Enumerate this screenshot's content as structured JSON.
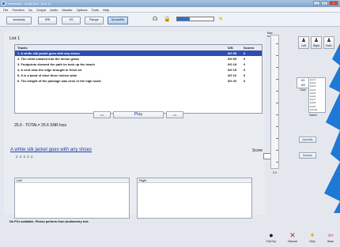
{
  "window": {
    "title": "Lessonsoft - Audio tool - [List 1]"
  },
  "menu": [
    "File",
    "Function",
    "Go",
    "Output",
    "Audio",
    "Monitor",
    "Options",
    "Tools",
    "Help"
  ],
  "toolbar": {
    "buttons": [
      {
        "label": "Audacity",
        "active": false
      },
      {
        "label": "SRI",
        "active": false
      },
      {
        "label": "SS",
        "active": false
      },
      {
        "label": "Range",
        "active": false
      },
      {
        "label": "SpeakMe",
        "active": true
      }
    ],
    "icons": [
      "headset-icon",
      "lock-icon",
      "sun-icon"
    ],
    "progress": 0.35,
    "accent": "#2e4eb3"
  },
  "list": {
    "title": "List 1",
    "columns": [
      "Tracks",
      "S/N",
      "Scores"
    ],
    "rows": [
      [
        "1. A white silk jacket goes with any shoes",
        "0/0 55",
        "0"
      ],
      [
        "2. The child crawled into the dense grass",
        "0/0 50",
        "0"
      ],
      [
        "3. Footprints showed the path he took up the beach",
        "0/0 18",
        "0"
      ],
      [
        "4. A vent near the edge brought in fresh air",
        "0/0 15",
        "0"
      ],
      [
        "5. It is a band of steel three inches wide",
        "0/0 10",
        "0"
      ],
      [
        "6. The weight of the package was seen in the high scale",
        "0/0 20",
        "0"
      ]
    ],
    "selected_row": 0
  },
  "playback": {
    "prev": "<<",
    "play": "Play",
    "next": ">>"
  },
  "totals": "25.6 - TOTAL= 25.6 SNR loss",
  "sentence": "A white silk jacket goes with any shoes",
  "phonemes": "2    2    2              2    2",
  "score": {
    "label": "Score",
    "value": ""
  },
  "panes": {
    "left": "Left",
    "right": "Right"
  },
  "status": "No PCs available. Please perform from Audiometry test.",
  "bottom_buttons": [
    {
      "label": "Full Grp",
      "icon": "person-icon"
    },
    {
      "label": "Discard",
      "icon": "close-icon"
    },
    {
      "label": "Help",
      "icon": "lightbulb-icon"
    },
    {
      "label": "Back",
      "icon": "back-arrow-icon"
    }
  ],
  "side": {
    "slider_top": "Max",
    "slider_top_value": "55 dB",
    "slider_bottom_value": "0.0",
    "talkers": [
      "Left",
      "Right",
      "Both"
    ],
    "count_box_label": "0/1",
    "count_box_sub": "100 Gain",
    "words": [
      "List 1",
      "List 2",
      "List 3",
      "List 4",
      "List 5",
      "List 6",
      "List 7",
      "List 8",
      "List 9",
      "List 10"
    ],
    "select_label": "Select",
    "btn1": "Quantify",
    "btn2": "Results"
  }
}
